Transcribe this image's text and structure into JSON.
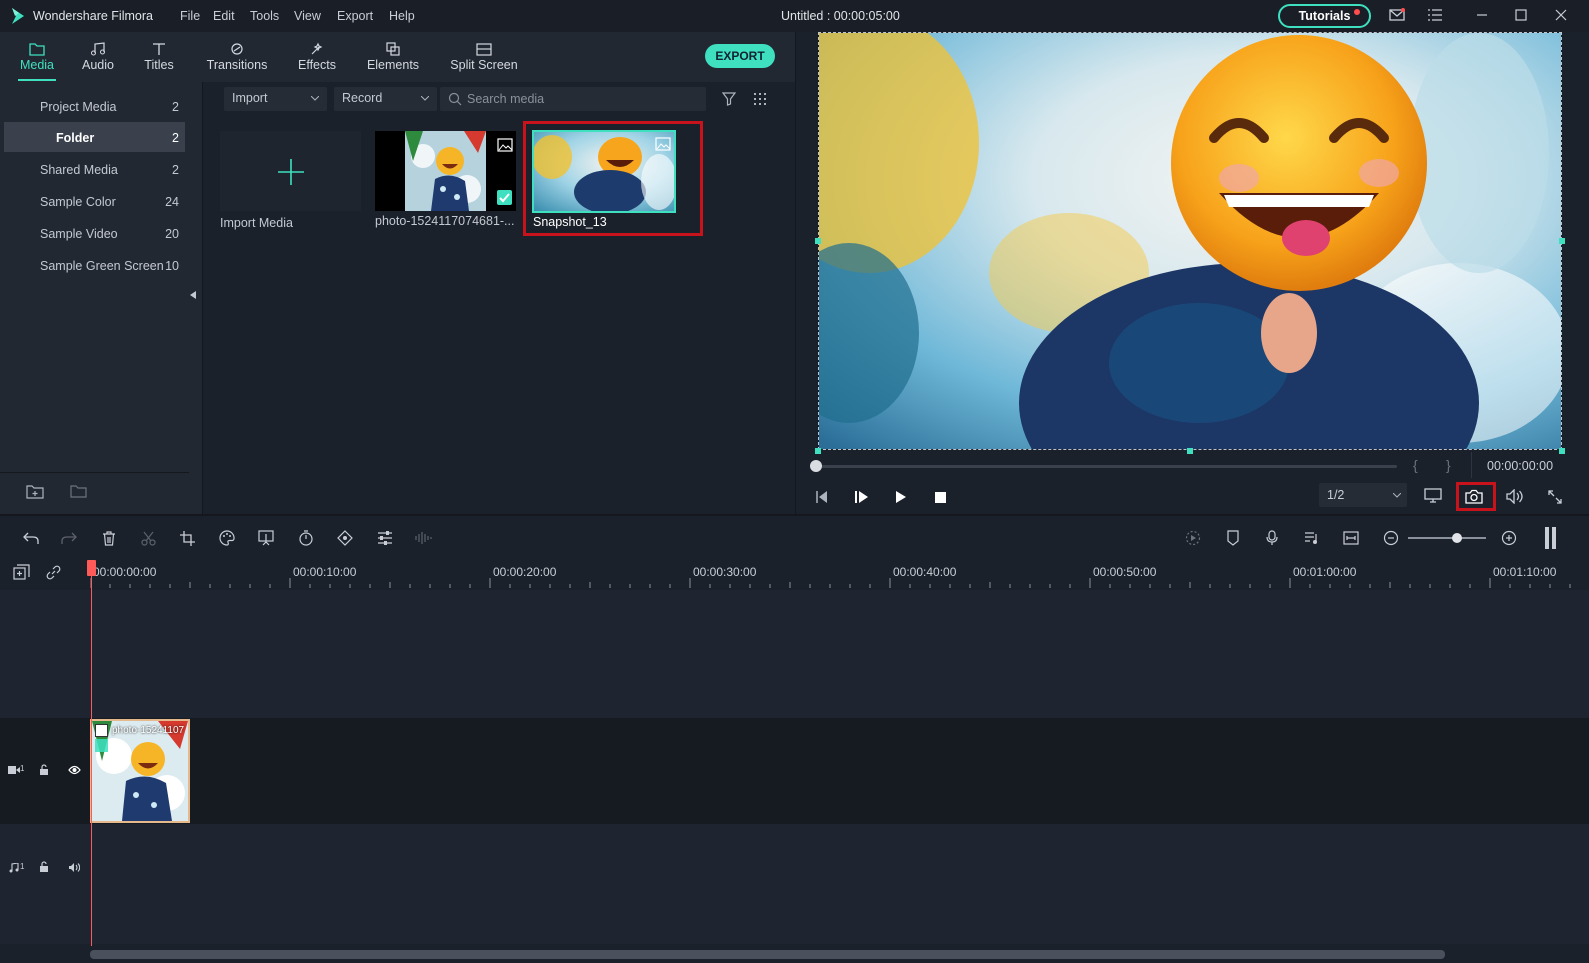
{
  "app": {
    "title": "Wondershare Filmora",
    "project_title": "Untitled : 00:00:05:00",
    "menu": [
      "File",
      "Edit",
      "Tools",
      "View",
      "Export",
      "Help"
    ],
    "tutorials_label": "Tutorials"
  },
  "tabs": [
    {
      "label": "Media",
      "icon": "folder-icon",
      "active": true
    },
    {
      "label": "Audio",
      "icon": "music-note-icon"
    },
    {
      "label": "Titles",
      "icon": "text-t-icon"
    },
    {
      "label": "Transitions",
      "icon": "transition-icon"
    },
    {
      "label": "Effects",
      "icon": "effects-icon"
    },
    {
      "label": "Elements",
      "icon": "elements-icon"
    },
    {
      "label": "Split Screen",
      "icon": "split-screen-icon"
    }
  ],
  "export_label": "EXPORT",
  "library": [
    {
      "name": "Project Media",
      "count": "2"
    },
    {
      "name": "Folder",
      "count": "2",
      "selected": true
    },
    {
      "name": "Shared Media",
      "count": "2"
    },
    {
      "name": "Sample Color",
      "count": "24"
    },
    {
      "name": "Sample Video",
      "count": "20"
    },
    {
      "name": "Sample Green Screen",
      "count": "10"
    }
  ],
  "media": {
    "import_dropdown": "Import",
    "record_dropdown": "Record",
    "search_placeholder": "Search media",
    "items": [
      {
        "caption": "Import Media"
      },
      {
        "caption": "photo-1524117074681-..."
      },
      {
        "caption": "Snapshot_13"
      }
    ]
  },
  "preview": {
    "timecode": "00:00:00:00",
    "quality": "1/2",
    "progress": 0
  },
  "timeline": {
    "ruler": [
      "00:00:00:00",
      "00:00:10:00",
      "00:00:20:00",
      "00:00:30:00",
      "00:00:40:00",
      "00:00:50:00",
      "00:01:00:00",
      "00:01:10:00"
    ],
    "clip_label": "photo-15241107",
    "video_track_label": "1",
    "audio_track_label": "1"
  },
  "colors": {
    "accent": "#3ee0c0",
    "highlight": "#c8131c",
    "playhead": "#ff5a5a"
  }
}
